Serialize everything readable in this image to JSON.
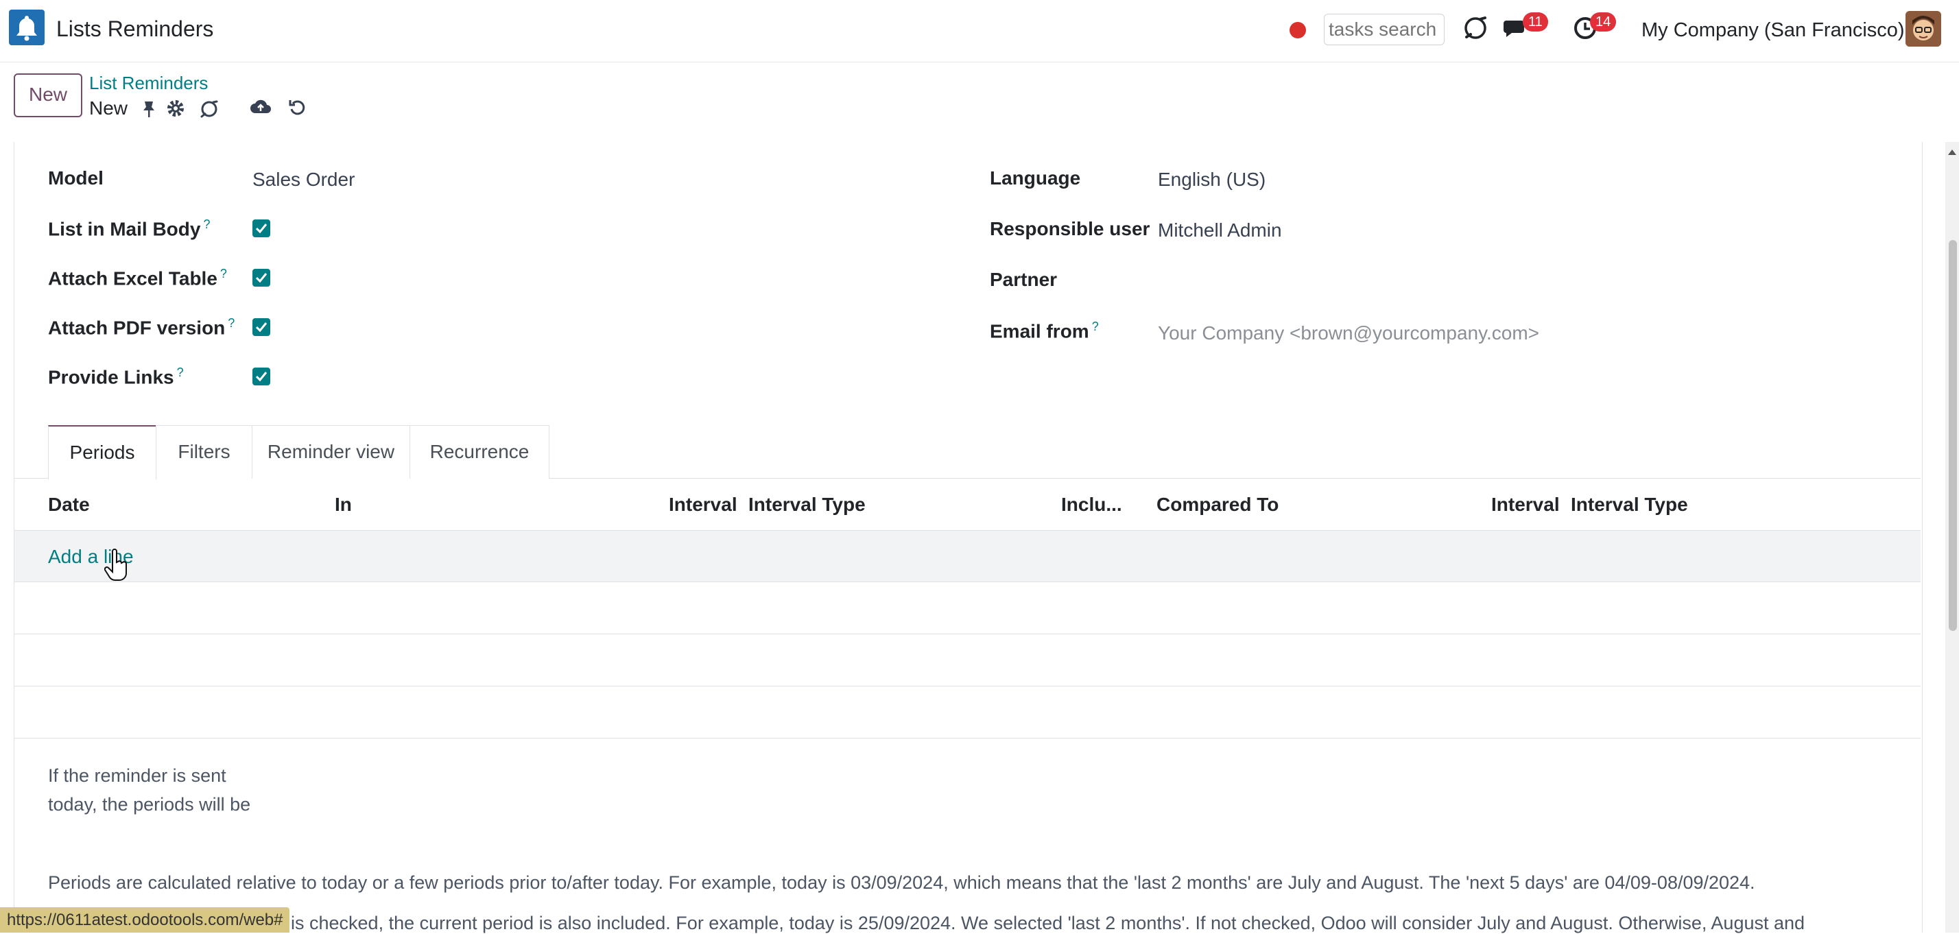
{
  "navbar": {
    "app_title": "Lists Reminders",
    "search_placeholder": "tasks search",
    "messages_count": "11",
    "activities_count": "14",
    "company": "My Company (San Francisco)"
  },
  "control_panel": {
    "new_button": "New",
    "breadcrumb_parent": "List Reminders",
    "breadcrumb_current": "New"
  },
  "form": {
    "left": [
      {
        "label": "Model",
        "value": "Sales Order",
        "help": false
      },
      {
        "label": "List in Mail Body",
        "checked": true,
        "help": true
      },
      {
        "label": "Attach Excel Table",
        "checked": true,
        "help": true
      },
      {
        "label": "Attach PDF version",
        "checked": true,
        "help": true
      },
      {
        "label": "Provide Links",
        "checked": true,
        "help": true
      }
    ],
    "right": [
      {
        "label": "Language",
        "value": "English (US)",
        "help": false
      },
      {
        "label": "Responsible user",
        "value": "Mitchell Admin",
        "help": false
      },
      {
        "label": "Partner",
        "value": "",
        "help": false
      },
      {
        "label": "Email from",
        "value": "Your Company <brown@yourcompany.com>",
        "help": true
      }
    ],
    "help_mark": "?"
  },
  "tabs": [
    "Periods",
    "Filters",
    "Reminder view",
    "Recurrence"
  ],
  "table": {
    "headers": [
      "Date",
      "In",
      "Interval",
      "Interval Type",
      "Inclu...",
      "Compared To",
      "Interval",
      "Interval Type"
    ],
    "add_line": "Add a line"
  },
  "notes": {
    "periods_hint": "If the reminder is sent today, the periods will be",
    "para1": "Periods are calculated relative to today or a few periods prior to/after today. For example, today is 03/09/2024, which means that the 'last 2 months' are July and August. The 'next 5 days' are 04/09-08/09/2024.",
    "para2": "is checked, the current period is also included. For example, today is 25/09/2024. We selected 'last 2 months'. If not checked, Odoo will consider July and August. Otherwise, August and"
  },
  "status_bar_url": "https://0611atest.odootools.com/web#",
  "colors": {
    "accent": "#017e84",
    "brand": "#714b67",
    "badge": "#e0303a",
    "record": "#d9302c"
  }
}
